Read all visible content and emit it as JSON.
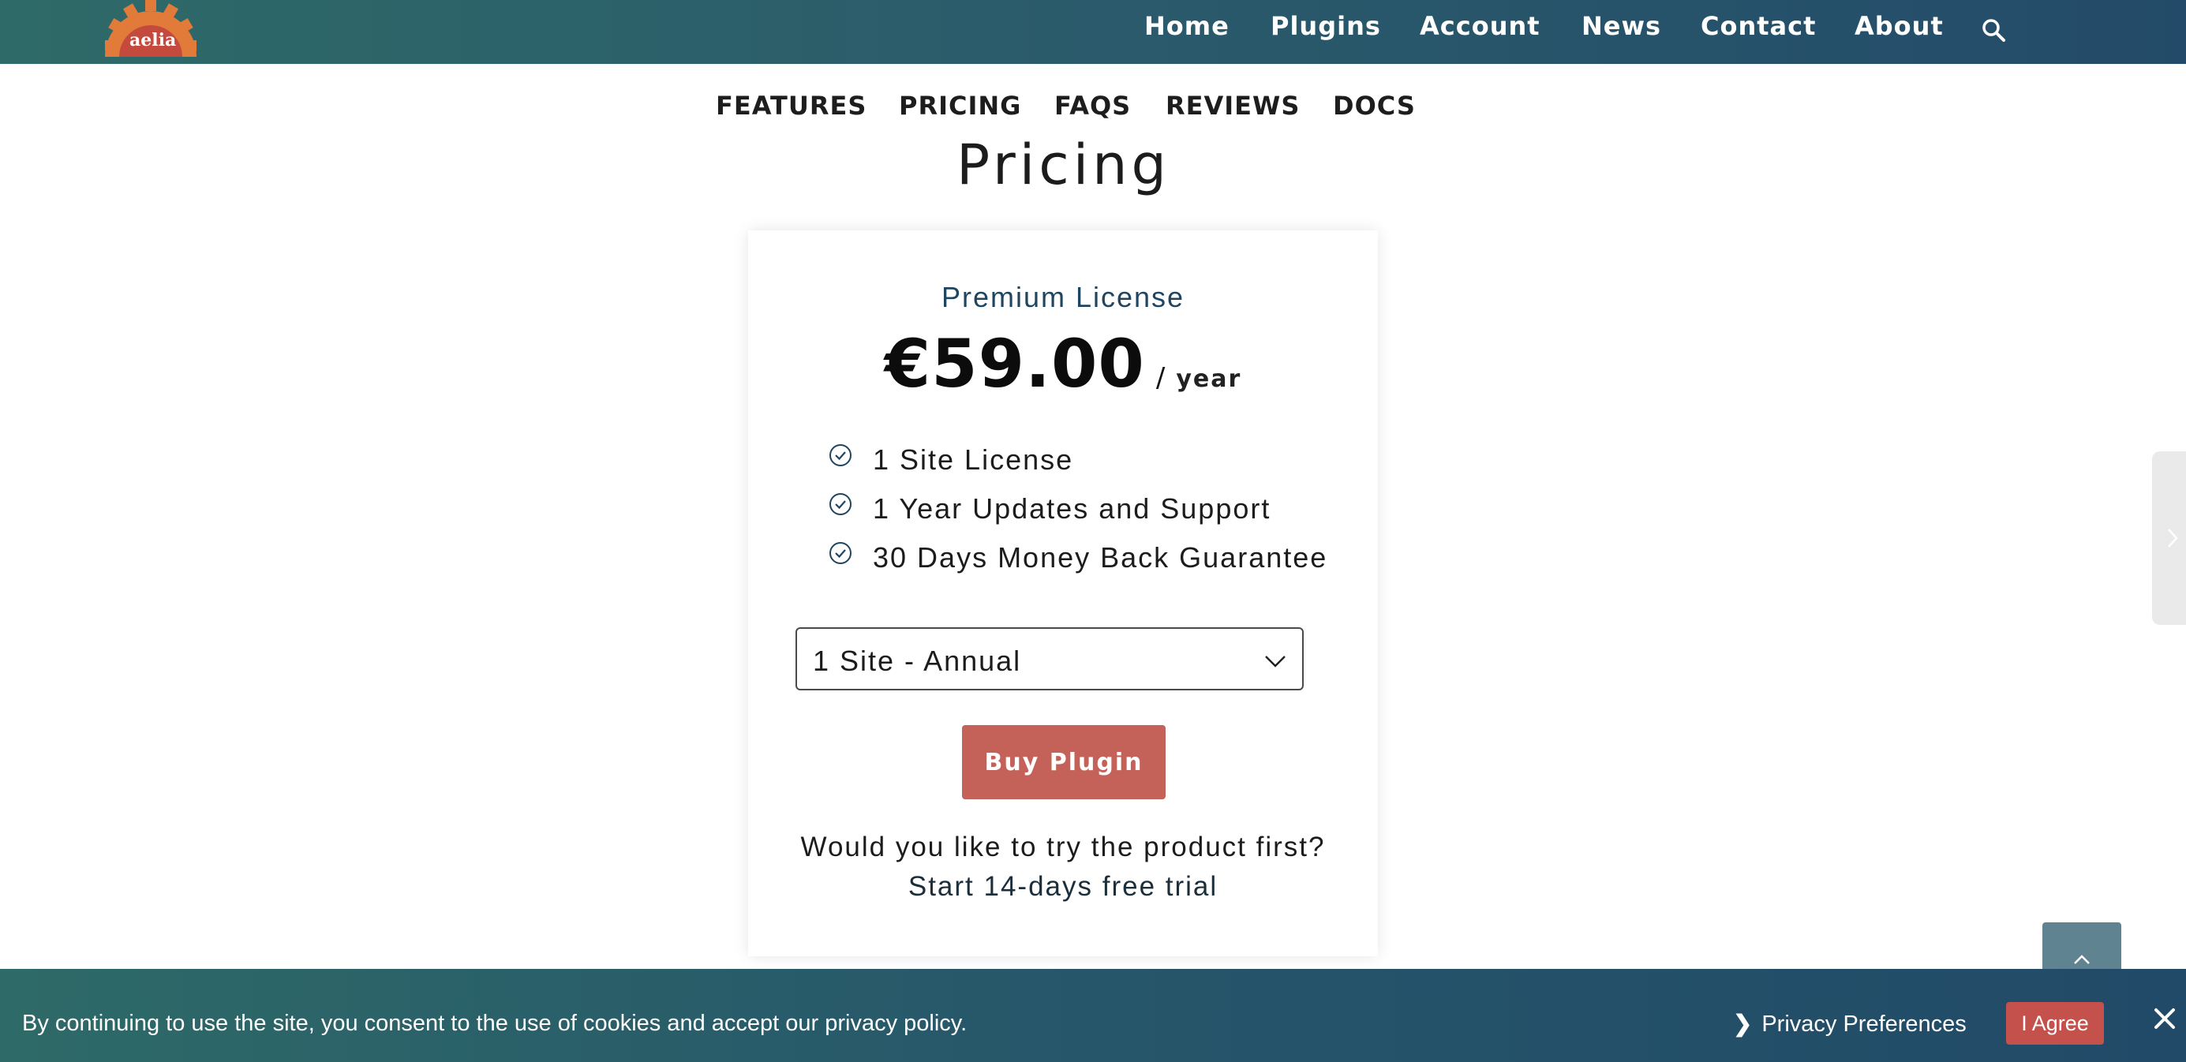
{
  "header": {
    "logo_text": "aelia",
    "nav": [
      "Home",
      "Plugins",
      "Account",
      "News",
      "Contact",
      "About"
    ],
    "search_icon": "search-icon"
  },
  "subnav": [
    "FEATURES",
    "PRICING",
    "FAQS",
    "REVIEWS",
    "DOCS"
  ],
  "page_title": "Pricing",
  "card": {
    "license": "Premium License",
    "price": "€59.00",
    "slash": "/",
    "period": "year",
    "features": [
      "1 Site License",
      "1 Year Updates and Support",
      "30 Days Money Back Guarantee"
    ],
    "select_value": "1 Site - Annual",
    "buy_label": "Buy Plugin",
    "trial_question": "Would you like to try the product first?",
    "trial_link": "Start 14-days free trial"
  },
  "cookie": {
    "message": "By continuing to use the site, you consent to the use of cookies and accept our privacy policy.",
    "prefs_arrow": "❯",
    "prefs_label": "Privacy Preferences",
    "agree_label": "I Agree",
    "close_icon": "close-icon"
  },
  "colors": {
    "header": "#2b5c6b",
    "accent": "#c4625a",
    "link": "#1f4560"
  }
}
